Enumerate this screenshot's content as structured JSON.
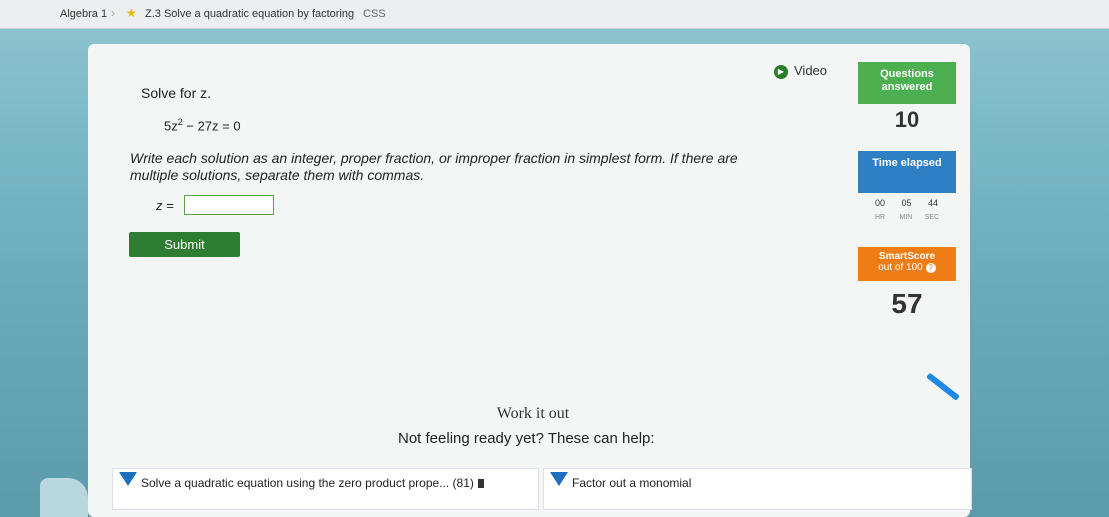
{
  "breadcrumb": {
    "subject": "Algebra 1",
    "skill": "Z.3 Solve a quadratic equation by factoring",
    "code": "CSS"
  },
  "video_label": "Video",
  "problem": {
    "prompt": "Solve for z.",
    "equation_left": "5z",
    "equation_exp": "2",
    "equation_right": " − 27z = 0",
    "instructions": "Write each solution as an integer, proper fraction, or improper fraction in simplest form. If there are multiple solutions, separate them with commas.",
    "answer_label": "z =",
    "answer_value": "",
    "submit_label": "Submit"
  },
  "stats": {
    "questions_label": "Questions answered",
    "questions_value": "10",
    "time_label": "Time elapsed",
    "hr": "00",
    "min": "05",
    "sec": "44",
    "hr_unit": "HR",
    "min_unit": "MIN",
    "sec_unit": "SEC",
    "smartscore_label": "SmartScore",
    "smartscore_sub": "out of 100",
    "smartscore_help": "?",
    "smartscore_value": "57"
  },
  "work_it_out": "Work it out",
  "not_ready": "Not feeling ready yet? These can help:",
  "help_links": [
    {
      "label": "Solve a quadratic equation using the zero product prope... (81)"
    },
    {
      "label": "Factor out a monomial"
    }
  ],
  "colors": {
    "green": "#4caf50",
    "blue": "#2f7fc4",
    "orange": "#ee7d16",
    "submit": "#2e7d32"
  }
}
